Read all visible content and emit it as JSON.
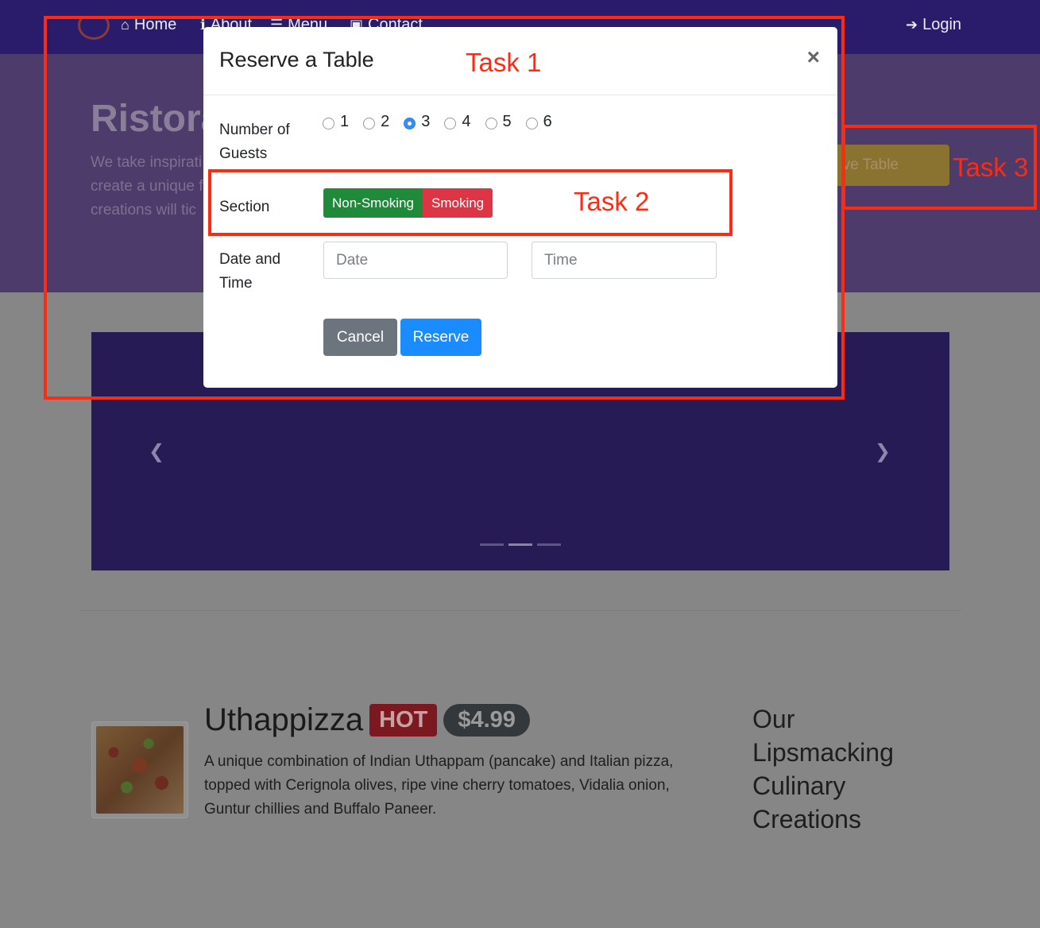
{
  "navbar": {
    "items": [
      {
        "label": "Home",
        "icon": "home-icon"
      },
      {
        "label": "About",
        "icon": "info-icon"
      },
      {
        "label": "Menu",
        "icon": "list-icon"
      },
      {
        "label": "Contact",
        "icon": "address-card-icon"
      }
    ],
    "login_label": "Login",
    "login_icon": "sign-in-icon"
  },
  "jumbotron": {
    "title": "Ristora",
    "text_lines": [
      "We take inspirati",
      "create a unique f",
      "creations will tic"
    ],
    "reserve_button_fragment": "ve Table",
    "reserve_button_color": "#ffc107"
  },
  "carousel": {
    "background": "#32217a",
    "indicator_count": 3,
    "active_indicator": 1
  },
  "dish": {
    "name": "Uthappizza",
    "badge_hot": "HOT",
    "price": "$4.99",
    "description": "A unique combination of Indian Uthappam (pancake) and Italian pizza, topped with Cerignola olives, ripe vine cherry tomatoes, Vidalia onion, Guntur chillies and Buffalo Paneer."
  },
  "side_heading": "Our Lipsmacking Culinary Creations",
  "modal": {
    "title": "Reserve a Table",
    "close_glyph": "×",
    "guests_label": "Number of Guests",
    "guest_options": [
      "1",
      "2",
      "3",
      "4",
      "5",
      "6"
    ],
    "guest_selected": "3",
    "section_label": "Section",
    "section_options": [
      "Non-Smoking",
      "Smoking"
    ],
    "datetime_label": "Date and Time",
    "date_placeholder": "Date",
    "time_placeholder": "Time",
    "cancel_label": "Cancel",
    "reserve_label": "Reserve"
  },
  "annotations": {
    "task1": "Task 1",
    "task2": "Task 2",
    "task3": "Task 3",
    "color": "#ff2a12"
  }
}
